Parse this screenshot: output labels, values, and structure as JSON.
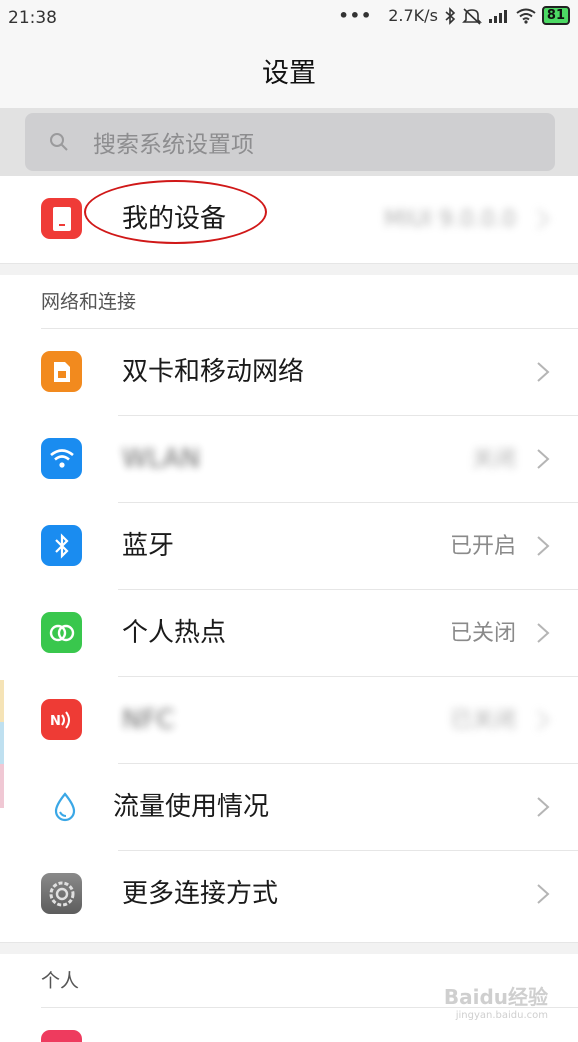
{
  "status_bar": {
    "time": "21:38",
    "dots": "•••",
    "net_speed": "2.7K/s",
    "battery": "81"
  },
  "header": {
    "title": "设置"
  },
  "search": {
    "placeholder": "搜索系统设置项"
  },
  "device_row": {
    "label": "我的设备",
    "value": "MIUI 9.0.0.0"
  },
  "sections": {
    "network": {
      "title": "网络和连接",
      "items": [
        {
          "label": "双卡和移动网络",
          "value": "",
          "icon": "sim-card-icon",
          "color": "#f28a1e"
        },
        {
          "label": "WLAN",
          "value": "关闭",
          "icon": "wifi-icon",
          "color": "#1a8cf0"
        },
        {
          "label": "蓝牙",
          "value": "已开启",
          "icon": "bluetooth-icon",
          "color": "#1a8cf0"
        },
        {
          "label": "个人热点",
          "value": "已关闭",
          "icon": "hotspot-icon",
          "color": "#39c74d"
        },
        {
          "label": "NFC",
          "value": "已关闭",
          "icon": "nfc-icon",
          "color": "#ee3b35"
        },
        {
          "label": "流量使用情况",
          "value": "",
          "icon": "data-usage-icon",
          "color": "#3aa7e6"
        },
        {
          "label": "更多连接方式",
          "value": "",
          "icon": "more-connections-icon",
          "color": "#7a7a7a"
        }
      ]
    },
    "personal": {
      "title": "个人"
    }
  },
  "watermark": {
    "brand": "Baidu经验",
    "url": "jingyan.baidu.com"
  },
  "colors": {
    "accent_red": "#d01818",
    "device_icon": "#ef3b37",
    "divider": "#e6e6e6",
    "section_bg": "#f2f2f2"
  }
}
